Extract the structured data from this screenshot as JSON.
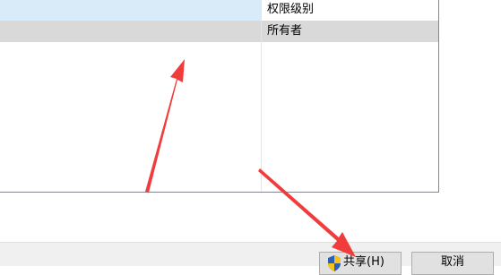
{
  "permissions_list": {
    "header_label": "权限级别",
    "selected_row_value": "所有者"
  },
  "footer": {
    "share_button_label": "共享(H)",
    "cancel_button_label": "取消"
  },
  "icons": {
    "share_button_icon": "uac-shield-icon",
    "annotation_arrows": "red-arrow-icon"
  },
  "colors": {
    "header_highlight": "#d9ebf9",
    "selected_row": "#d9d9d9",
    "arrow": "#f03c3c"
  }
}
